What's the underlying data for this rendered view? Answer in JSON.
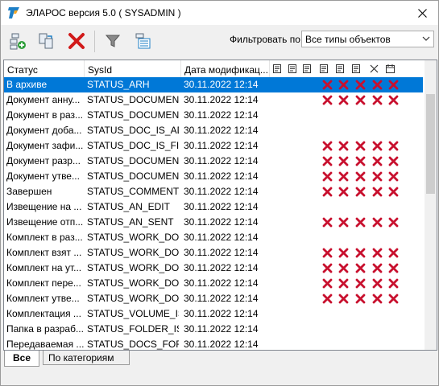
{
  "window": {
    "title": "ЭЛАРОС версия 5.0 ( SYSADMIN )"
  },
  "toolbar": {
    "buttons": [
      {
        "icon": "add-object-icon"
      },
      {
        "icon": "copy-object-icon"
      },
      {
        "icon": "delete-icon"
      },
      {
        "icon": "filter-icon"
      },
      {
        "icon": "view-settings-icon"
      }
    ],
    "filter_label": "Фильтровать по:",
    "filter_value": "Все типы объектов"
  },
  "table": {
    "columns": [
      "Статус",
      "SysId",
      "Дата модификац..."
    ],
    "icon_columns": [
      "create-icon",
      "edit-icon",
      "save-icon",
      "sign-icon",
      "approve-icon",
      "sign-edit-icon",
      "cut-icon",
      "calendar-icon"
    ],
    "rows": [
      {
        "status": "В архиве",
        "sysid": "STATUS_ARH",
        "date": "30.11.2022 12:14",
        "marks": true,
        "selected": true
      },
      {
        "status": "Документ анну...",
        "sysid": "STATUS_DOCUMEN...",
        "date": "30.11.2022 12:14",
        "marks": true,
        "selected": false
      },
      {
        "status": "Документ в раз...",
        "sysid": "STATUS_DOCUMEN...",
        "date": "30.11.2022 12:14",
        "marks": false,
        "selected": false
      },
      {
        "status": "Документ доба...",
        "sysid": "STATUS_DOC_IS_AD...",
        "date": "30.11.2022 12:14",
        "marks": false,
        "selected": false
      },
      {
        "status": "Документ зафи...",
        "sysid": "STATUS_DOC_IS_FIX...",
        "date": "30.11.2022 12:14",
        "marks": true,
        "selected": false
      },
      {
        "status": "Документ разр...",
        "sysid": "STATUS_DOCUMEN...",
        "date": "30.11.2022 12:14",
        "marks": true,
        "selected": false
      },
      {
        "status": "Документ утве...",
        "sysid": "STATUS_DOCUMEN...",
        "date": "30.11.2022 12:14",
        "marks": true,
        "selected": false
      },
      {
        "status": "Завершен",
        "sysid": "STATUS_COMMENT...",
        "date": "30.11.2022 12:14",
        "marks": true,
        "selected": false
      },
      {
        "status": "Извещение на ...",
        "sysid": "STATUS_AN_EDIT",
        "date": "30.11.2022 12:14",
        "marks": false,
        "selected": false
      },
      {
        "status": "Извещение отп...",
        "sysid": "STATUS_AN_SENT",
        "date": "30.11.2022 12:14",
        "marks": true,
        "selected": false
      },
      {
        "status": "Комплект в раз...",
        "sysid": "STATUS_WORK_DO...",
        "date": "30.11.2022 12:14",
        "marks": false,
        "selected": false
      },
      {
        "status": "Комплект взят ...",
        "sysid": "STATUS_WORK_DO...",
        "date": "30.11.2022 12:14",
        "marks": true,
        "selected": false
      },
      {
        "status": "Комплект на ут...",
        "sysid": "STATUS_WORK_DO...",
        "date": "30.11.2022 12:14",
        "marks": true,
        "selected": false
      },
      {
        "status": "Комплект пере...",
        "sysid": "STATUS_WORK_DO...",
        "date": "30.11.2022 12:14",
        "marks": true,
        "selected": false
      },
      {
        "status": "Комплект утве...",
        "sysid": "STATUS_WORK_DO...",
        "date": "30.11.2022 12:14",
        "marks": true,
        "selected": false
      },
      {
        "status": "Комплектация ...",
        "sysid": "STATUS_VOLUME_IS...",
        "date": "30.11.2022 12:14",
        "marks": false,
        "selected": false
      },
      {
        "status": "Папка в разраб...",
        "sysid": "STATUS_FOLDER_IS_...",
        "date": "30.11.2022 12:14",
        "marks": false,
        "selected": false
      },
      {
        "status": "Передаваемая ...",
        "sysid": "STATUS_DOCS_FOR...",
        "date": "30.11.2022 12:14",
        "marks": false,
        "selected": false
      }
    ]
  },
  "tabs": [
    "Все",
    "По категориям"
  ],
  "colors": {
    "selection": "#0078d7",
    "mark": "#c8102e"
  }
}
